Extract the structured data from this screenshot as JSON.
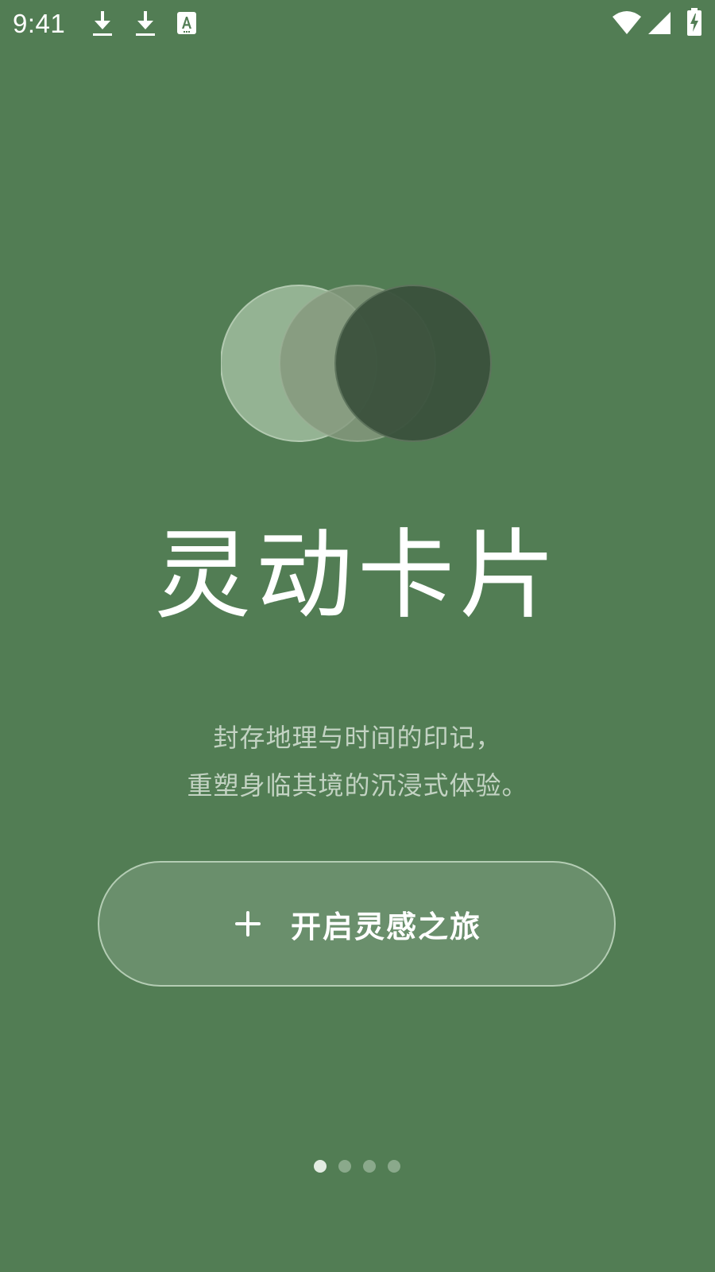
{
  "status_bar": {
    "time": "9:41",
    "notification_icons": [
      "download-icon",
      "download-icon",
      "translate-icon"
    ],
    "system_icons": [
      "wifi-icon",
      "cellular-signal-icon",
      "battery-charging-icon"
    ]
  },
  "onboarding": {
    "title": "灵动卡片",
    "subtitle_line1": "封存地理与时间的印记，",
    "subtitle_line2": "重塑身临其境的沉浸式体验。",
    "cta_label": "开启灵感之旅",
    "cta_icon": "plus-icon",
    "page_indicator": {
      "total": 4,
      "active_index": 0
    }
  },
  "colors": {
    "background": "#527d54",
    "circle_light": "#94b393",
    "circle_mid": "#85997e",
    "circle_dark": "#39503b",
    "cta_border": "#cee2cc",
    "subtitle_text": "#c3d3c3"
  }
}
